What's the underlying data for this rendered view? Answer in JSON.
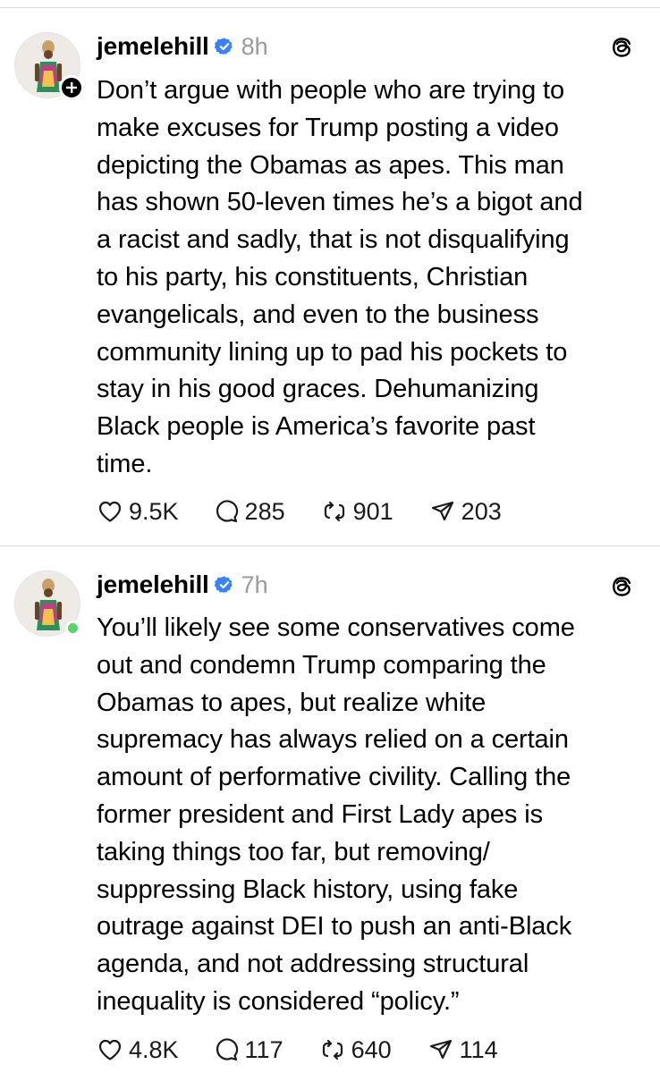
{
  "posts": [
    {
      "username": "jemelehill",
      "time": "8h",
      "avatar_badge": "follow-plus",
      "text": "Don’t argue with people who are trying to\nmake excuses for Trump posting a video\ndepicting the Obamas as apes. This man\nhas shown 50-leven times he’s a bigot and\na racist and sadly, that is not disqualifying\nto his party, his constituents, Christian\nevangelicals, and even to the business\ncommunity lining up to pad his pockets to\nstay in his good graces. Dehumanizing\nBlack people is America’s favorite past\ntime.",
      "likes": "9.5K",
      "replies": "285",
      "reposts": "901",
      "shares": "203"
    },
    {
      "username": "jemelehill",
      "time": "7h",
      "avatar_badge": "online-dot",
      "text": "You’ll likely see some conservatives come\nout and condemn Trump comparing the\nObamas to apes, but realize white\nsupremacy has always relied on a certain\namount of performative civility. Calling the\nformer president and First Lady apes is\ntaking things too far, but removing/\nsuppressing Black history, using fake\noutrage against DEI to push an anti-Black\nagenda, and not addressing structural\ninequality is considered “policy.”",
      "likes": "4.8K",
      "replies": "117",
      "reposts": "640",
      "shares": "114"
    }
  ],
  "colors": {
    "verified": "#3b82f6",
    "muted": "#9a9a9a",
    "online": "#5ad468",
    "divider": "#d9d9d9"
  },
  "icons": {
    "verified": "verified-badge-icon",
    "threads": "threads-logo-icon",
    "like": "heart-icon",
    "reply": "comment-icon",
    "repost": "repost-icon",
    "share": "send-icon"
  }
}
